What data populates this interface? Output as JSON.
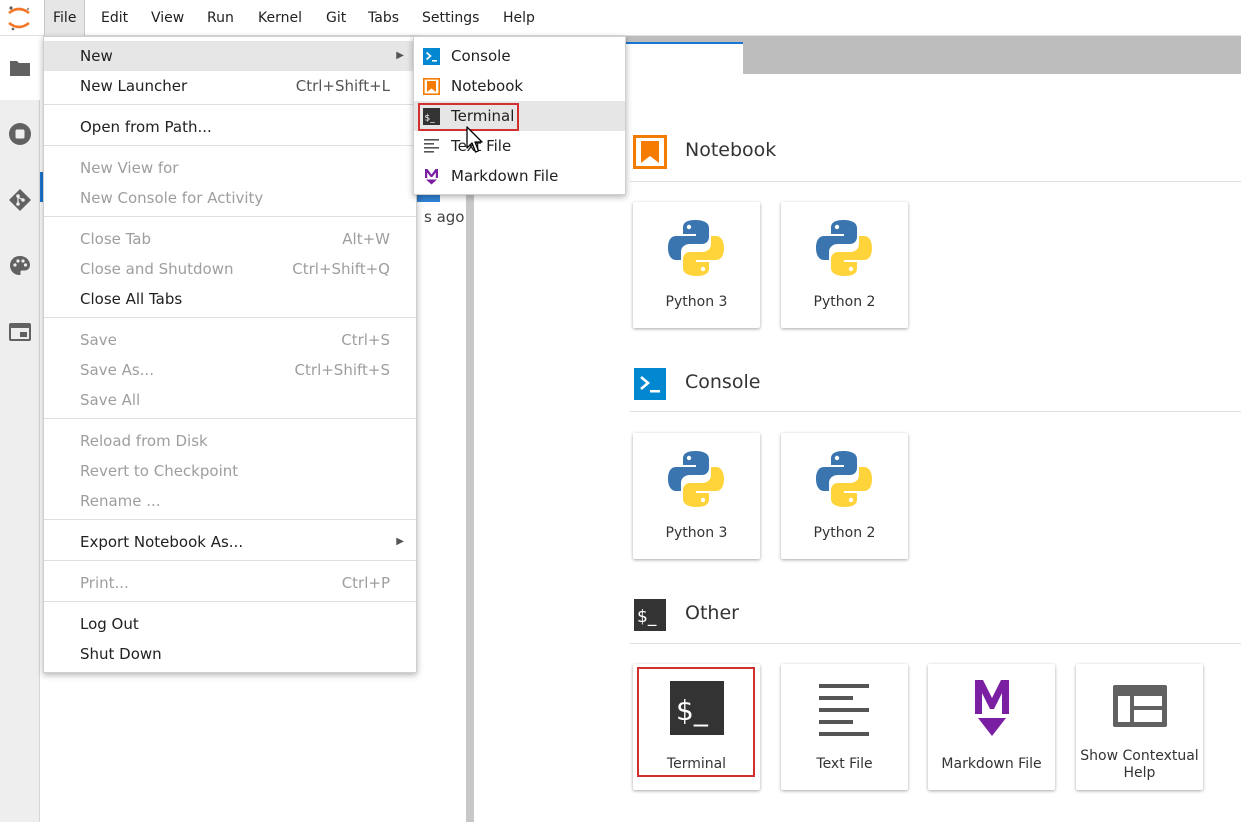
{
  "menubar": {
    "items": [
      "File",
      "Edit",
      "View",
      "Run",
      "Kernel",
      "Git",
      "Tabs",
      "Settings",
      "Help"
    ],
    "active": "File"
  },
  "icons": {
    "logo": "jupyter-logo",
    "leftbar": [
      "folder-icon",
      "running-icon",
      "git-icon",
      "palette-icon",
      "tabs-icon"
    ]
  },
  "filebrowser": {
    "ago_text": "s ago"
  },
  "file_menu": {
    "new": "New",
    "new_launcher": {
      "label": "New Launcher",
      "shortcut": "Ctrl+Shift+L"
    },
    "open_from_path": "Open from Path...",
    "new_view_for": "New View for",
    "new_console_for_activity": "New Console for Activity",
    "close_tab": {
      "label": "Close Tab",
      "shortcut": "Alt+W"
    },
    "close_and_shutdown": {
      "label": "Close and Shutdown",
      "shortcut": "Ctrl+Shift+Q"
    },
    "close_all_tabs": "Close All Tabs",
    "save": {
      "label": "Save",
      "shortcut": "Ctrl+S"
    },
    "save_as": {
      "label": "Save As...",
      "shortcut": "Ctrl+Shift+S"
    },
    "save_all": "Save All",
    "reload_from_disk": "Reload from Disk",
    "revert_to_checkpoint": "Revert to Checkpoint",
    "rename": "Rename ...",
    "export_notebook_as": "Export Notebook As...",
    "print": {
      "label": "Print...",
      "shortcut": "Ctrl+P"
    },
    "log_out": "Log Out",
    "shut_down": "Shut Down"
  },
  "new_submenu": {
    "console": "Console",
    "notebook": "Notebook",
    "terminal": "Terminal",
    "text_file": "Text File",
    "markdown_file": "Markdown File"
  },
  "launcher": {
    "notebook_section": "Notebook",
    "console_section": "Console",
    "other_section": "Other",
    "notebook_cards": [
      "Python 3",
      "Python 2"
    ],
    "console_cards": [
      "Python 3",
      "Python 2"
    ],
    "other_cards": {
      "terminal": "Terminal",
      "text_file": "Text File",
      "markdown_file": "Markdown File",
      "contextual_help_line1": "Show Contextual",
      "contextual_help_line2": "Help"
    }
  },
  "colors": {
    "accent_blue": "#1976d2",
    "notebook_orange": "#f57c00",
    "console_blue": "#0288d1",
    "markdown_purple": "#7b1fa2",
    "highlight_red": "#d32f2f"
  }
}
